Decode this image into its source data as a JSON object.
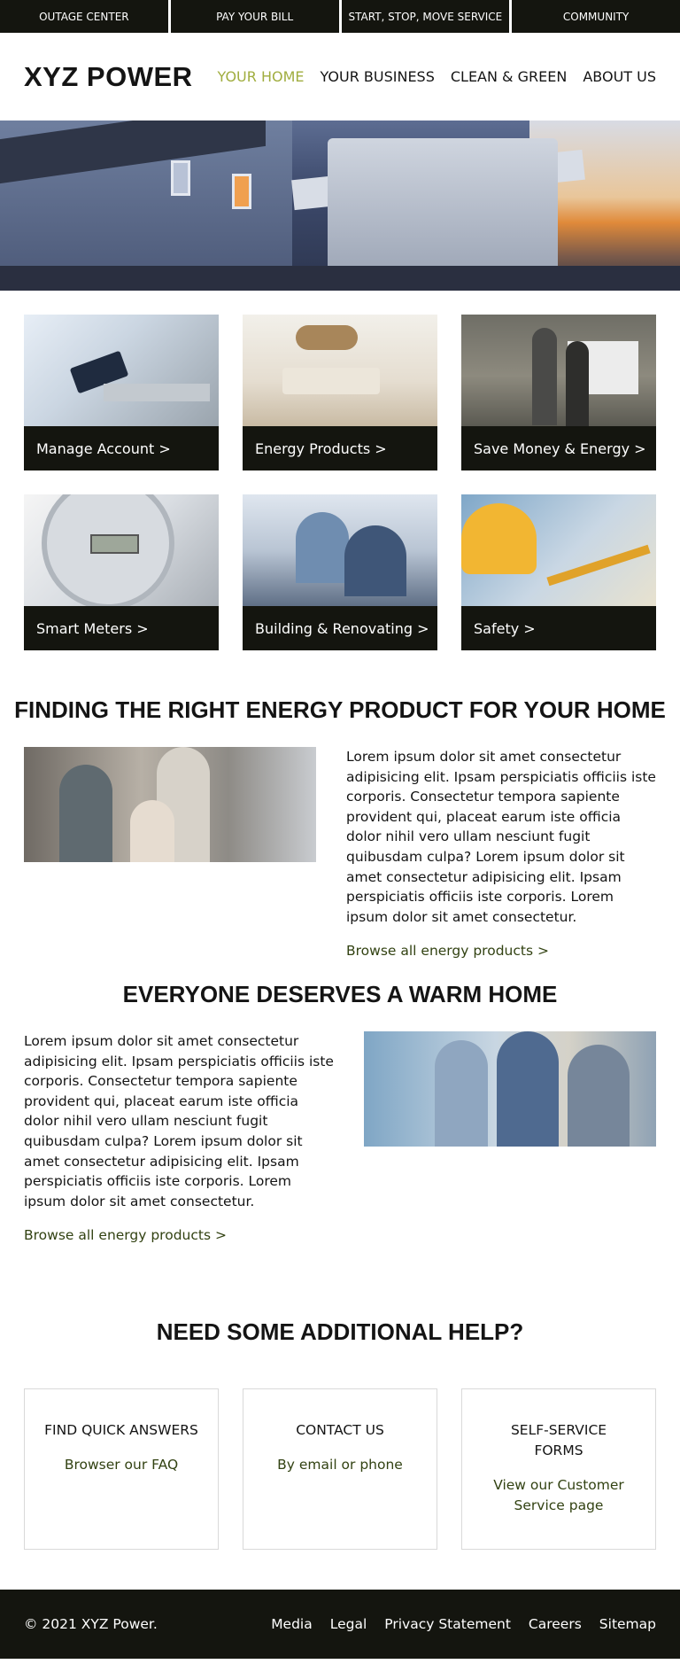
{
  "topbar": {
    "items": [
      "OUTAGE CENTER",
      "PAY YOUR BILL",
      "START, STOP, MOVE SERVICE",
      "COMMUNITY"
    ]
  },
  "header": {
    "logo": "XYZ POWER",
    "nav": [
      "YOUR HOME",
      "YOUR BUSINESS",
      "CLEAN & GREEN",
      "ABOUT US"
    ],
    "active_nav": "YOUR HOME"
  },
  "tiles": [
    {
      "label": "Manage Account >"
    },
    {
      "label": "Energy Products >"
    },
    {
      "label": "Save Money & Energy >"
    },
    {
      "label": "Smart Meters >"
    },
    {
      "label": "Building & Renovating >"
    },
    {
      "label": "Safety >"
    }
  ],
  "section1": {
    "title": "FINDING THE RIGHT ENERGY PRODUCT FOR YOUR HOME",
    "body": "Lorem ipsum dolor sit amet consectetur adipisicing elit. Ipsam perspiciatis officiis iste corporis. Consectetur tempora sapiente provident qui, placeat earum iste officia dolor nihil vero ullam nesciunt fugit quibusdam culpa? Lorem ipsum dolor sit amet consectetur adipisicing elit. Ipsam perspiciatis officiis iste corporis. Lorem ipsum dolor sit amet consectetur.",
    "link": "Browse all energy products >"
  },
  "section2": {
    "title": "EVERYONE DESERVES A WARM HOME",
    "body": "Lorem ipsum dolor sit amet consectetur adipisicing elit. Ipsam perspiciatis officiis iste corporis. Consectetur tempora sapiente provident qui, placeat earum iste officia dolor nihil vero ullam nesciunt fugit quibusdam culpa? Lorem ipsum dolor sit amet consectetur adipisicing elit. Ipsam perspiciatis officiis iste corporis. Lorem ipsum dolor sit amet consectetur.",
    "link": "Browse all energy products >"
  },
  "help": {
    "title": "NEED SOME ADDITIONAL HELP?",
    "cards": [
      {
        "title": "FIND QUICK ANSWERS",
        "link": "Browser our FAQ"
      },
      {
        "title": "CONTACT US",
        "link": "By email or phone"
      },
      {
        "title": "SELF-SERVICE FORMS",
        "link": "View our Customer Service page"
      }
    ]
  },
  "footer": {
    "copyright": "© 2021 XYZ Power.",
    "links": [
      "Media",
      "Legal",
      "Privacy Statement",
      "Careers",
      "Sitemap"
    ]
  },
  "colors": {
    "dark": "#14150f",
    "accent_active": "#a0ad3f",
    "link_green": "#324212"
  }
}
